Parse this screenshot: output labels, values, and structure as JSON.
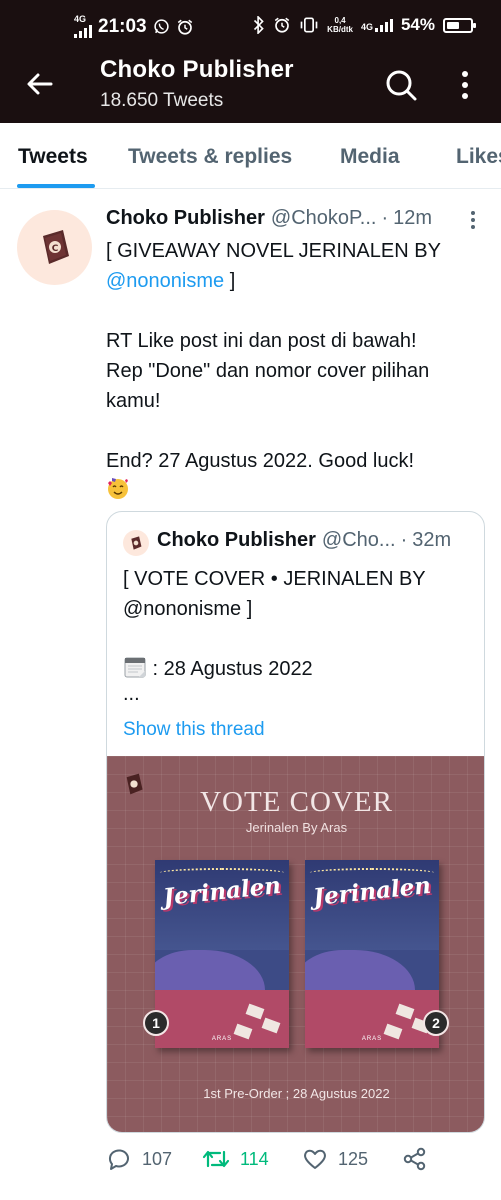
{
  "status_bar": {
    "network_left": "4G",
    "time": "21:03",
    "speed_value": "0,4",
    "speed_unit": "KB/dtk",
    "network_right": "4G",
    "battery": "54%",
    "battery_level": 0.54,
    "icons": [
      "whatsapp-icon",
      "alarm-icon",
      "bluetooth-icon",
      "alarm-icon",
      "vibrate-icon",
      "battery-icon"
    ]
  },
  "header": {
    "title": "Choko Publisher",
    "subtitle": "18.650 Tweets",
    "icons": [
      "back-arrow-icon",
      "search-icon",
      "more-vertical-icon"
    ]
  },
  "tabs": [
    {
      "label": "Tweets",
      "active": true
    },
    {
      "label": "Tweets & replies",
      "active": false
    },
    {
      "label": "Media",
      "active": false
    },
    {
      "label": "Likes",
      "active": false
    }
  ],
  "tweet": {
    "author_name": "Choko Publisher",
    "author_handle": "@ChokoP...",
    "separator": "·",
    "time": "12m",
    "line1": "[ GIVEAWAY NOVEL JERINALEN BY",
    "mention": "@nononisme",
    "line2_tail": " ]",
    "para2_line1": "RT Like post ini dan post di bawah!",
    "para2_line2": "Rep \"Done\" dan nomor cover pilihan",
    "para2_line3": "kamu!",
    "para3": "End? 27 Agustus 2022. Good luck!",
    "emoji": "smiling-face-with-hearts-icon"
  },
  "quote": {
    "author_name": "Choko Publisher",
    "author_handle": "@Cho...",
    "separator": "·",
    "time": "32m",
    "line1": "[ VOTE COVER • JERINALEN BY",
    "line2": "@nononisme ]",
    "date_line": " : 28 Agustus 2022",
    "ellipsis": "...",
    "show_thread": "Show this thread",
    "media": {
      "title": "VOTE COVER",
      "subtitle": "Jerinalen By Aras",
      "cover_title": "Jerinalen",
      "cover_author": "ARAS",
      "badge1": "1",
      "badge2": "2",
      "footer": "1st Pre-Order ; 28 Agustus 2022"
    }
  },
  "actions": {
    "replies": "107",
    "retweets": "114",
    "likes": "125",
    "icons": [
      "reply-icon",
      "retweet-icon",
      "like-icon",
      "share-icon"
    ],
    "retweet_color": "#00ba7c"
  },
  "colors": {
    "header_bg": "#1a0f10",
    "accent": "#1d9bf0",
    "media_bg": "#8c5b5f"
  }
}
